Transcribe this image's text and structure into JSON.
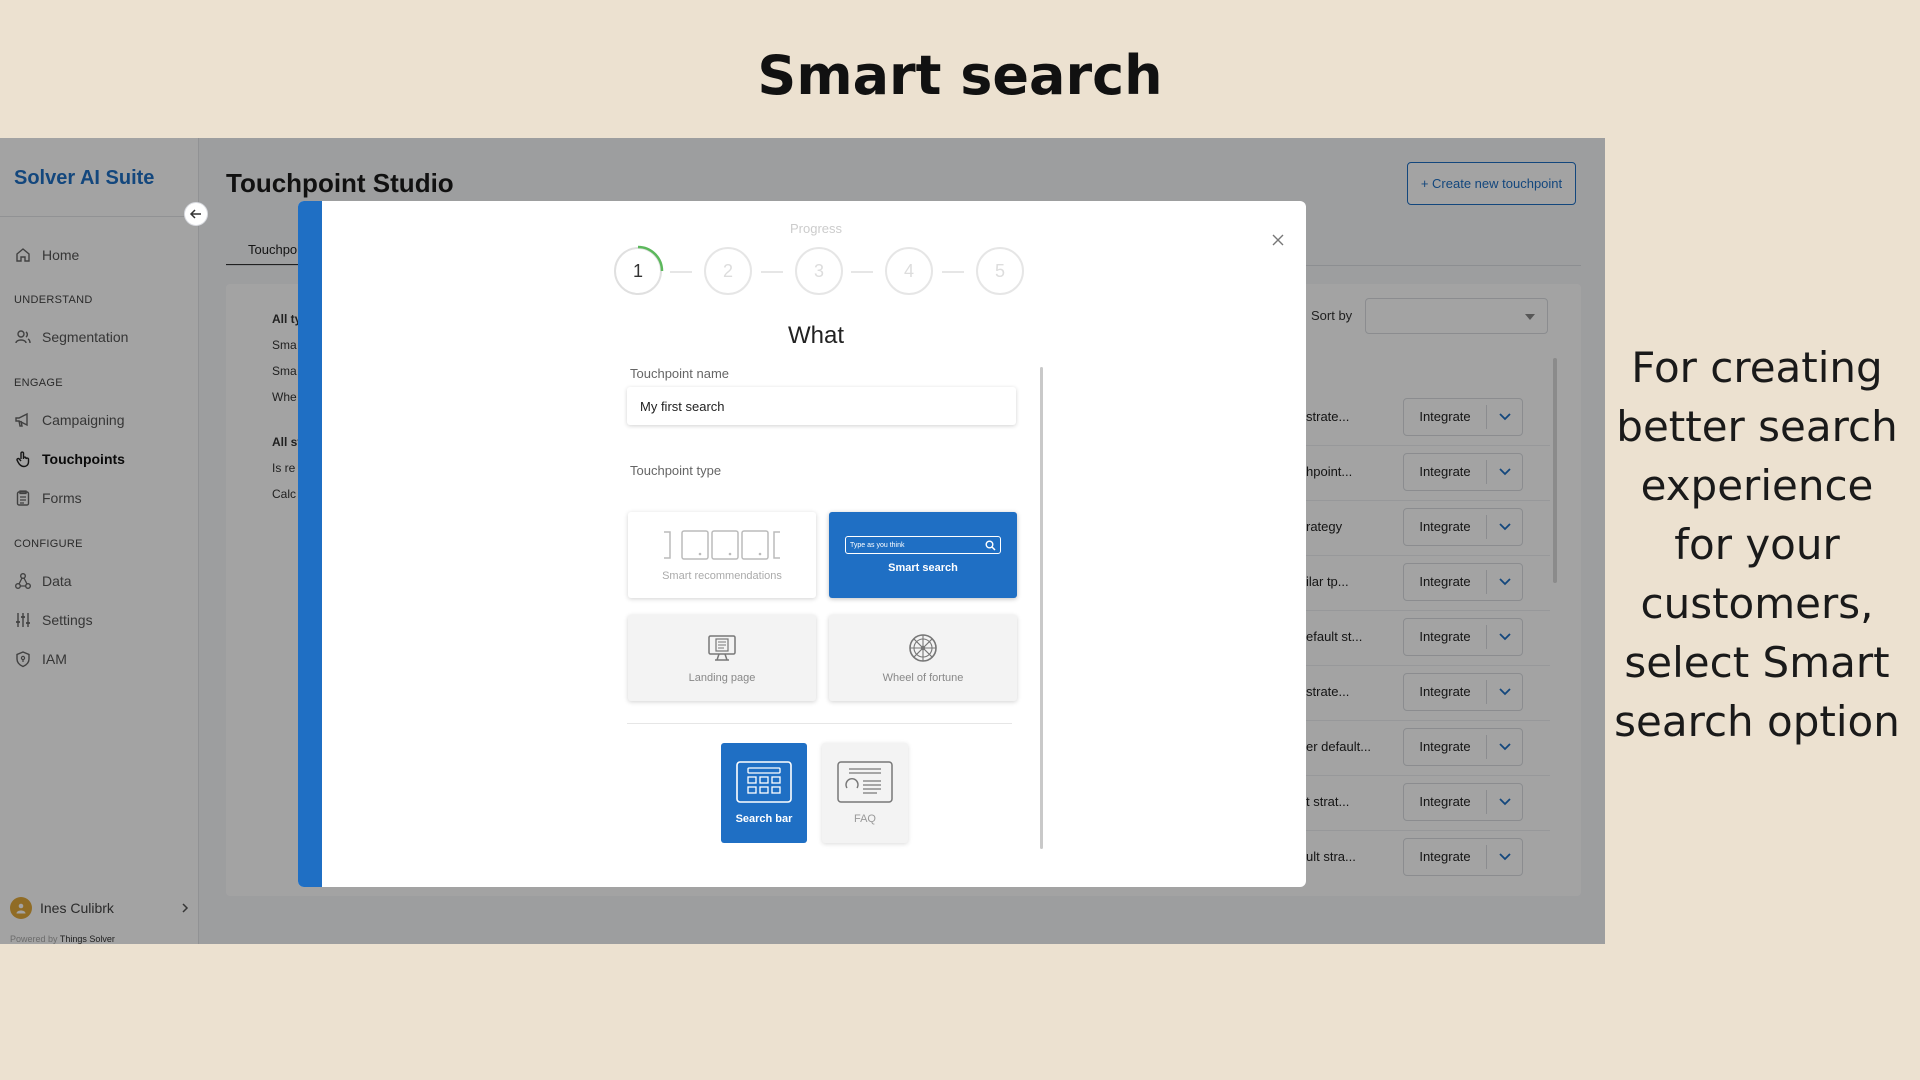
{
  "slide": {
    "title": "Smart search",
    "caption": "For creating better search experience for your customers, select Smart search option"
  },
  "sidebar": {
    "brand": "Solver AI Suite",
    "home": "Home",
    "section_understand": "UNDERSTAND",
    "segmentation": "Segmentation",
    "section_engage": "ENGAGE",
    "campaigning": "Campaigning",
    "touchpoints": "Touchpoints",
    "forms": "Forms",
    "section_configure": "CONFIGURE",
    "data": "Data",
    "settings": "Settings",
    "iam": "IAM",
    "user_name": "Ines Culibrk",
    "powered_prefix": "Powered by",
    "powered_company": "Things Solver"
  },
  "main": {
    "title": "Touchpoint Studio",
    "create_button": "+ Create new touchpoint",
    "active_tab": "Touchpo",
    "sort_label": "Sort by",
    "sort_value": "",
    "filters": [
      "All ty",
      "Sma",
      "Sma",
      "Whe",
      "All st",
      "Is re",
      "Calc"
    ],
    "rows": [
      {
        "text": "strate...",
        "action": "Integrate"
      },
      {
        "text": "hpoint...",
        "action": "Integrate"
      },
      {
        "text": "rategy",
        "action": "Integrate"
      },
      {
        "text": "ilar tp...",
        "action": "Integrate"
      },
      {
        "text": "efault st...",
        "action": "Integrate"
      },
      {
        "text": "strate...",
        "action": "Integrate"
      },
      {
        "text": "er default...",
        "action": "Integrate"
      },
      {
        "text": "t strat...",
        "action": "Integrate"
      },
      {
        "text": "ult stra...",
        "action": "Integrate"
      }
    ]
  },
  "modal": {
    "progress_label": "Progress",
    "steps": [
      "1",
      "2",
      "3",
      "4",
      "5"
    ],
    "current_step": 1,
    "heading": "What",
    "name_label": "Touchpoint name",
    "name_value": "My first search",
    "type_label": "Touchpoint type",
    "types": {
      "smart_recommendations": "Smart recommendations",
      "smart_search": "Smart search",
      "landing_page": "Landing page",
      "wheel_of_fortune": "Wheel of fortune"
    },
    "selected_type": "Smart search",
    "search_placeholder": "Type as you think",
    "subtypes": {
      "search_bar": "Search bar",
      "faq": "FAQ"
    },
    "selected_subtype": "Search bar"
  },
  "colors": {
    "accent": "#1f6fc4",
    "slide_background": "#ece1d0",
    "progress_arc": "#5cb85c"
  }
}
